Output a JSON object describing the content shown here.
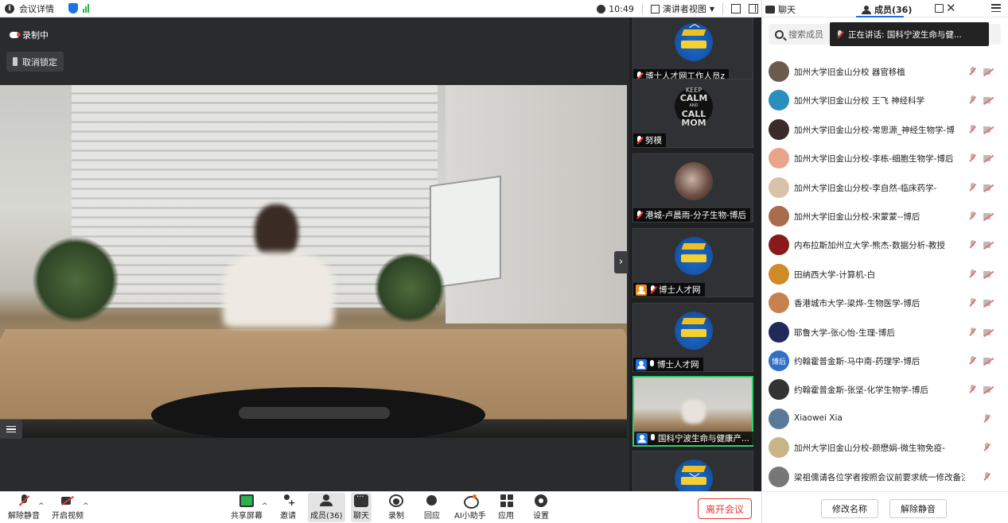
{
  "topbar": {
    "meeting_info": "会议详情",
    "time": "10:49",
    "view_mode": "演讲者视图"
  },
  "stage": {
    "recording": "录制中",
    "unlock": "取消锁定"
  },
  "thumbnails": [
    {
      "name": "博士人才网工作人员z",
      "mic": "off",
      "avatar": "logo-avatar"
    },
    {
      "name": "努模",
      "mic": "off",
      "avatar": "keep-calm-avatar",
      "avatar_text": [
        "KEEP",
        "CALM",
        "AND",
        "CALL",
        "MOM"
      ]
    },
    {
      "name": "港城-卢晨雨-分子生物-博后",
      "mic": "off",
      "avatar": "cat-avatar"
    },
    {
      "name": "博士人才网",
      "mic": "off",
      "avatar": "logo-avatar",
      "host_color": "#f08c1a"
    },
    {
      "name": "博士人才网",
      "mic": "on",
      "avatar": "logo-avatar",
      "host_color": "#1a73e8"
    },
    {
      "name": "国科宁波生命与健康产...",
      "mic": "on",
      "avatar": "video",
      "host_color": "#1a73e8",
      "active": true
    }
  ],
  "toolbar": {
    "unmute": "解除静音",
    "start_video": "开启视频",
    "share": "共享屏幕",
    "invite": "邀请",
    "members": "成员(36)",
    "chat": "聊天",
    "record": "录制",
    "react": "回应",
    "ai": "AI小助手",
    "apps": "应用",
    "settings": "设置",
    "leave": "离开会议"
  },
  "panel": {
    "tab_chat": "聊天",
    "tab_members": "成员(36)",
    "search_placeholder": "搜索成员",
    "speaking": "正在讲话: 国科宁波生命与健...",
    "members": [
      {
        "name": "加州大学旧金山分校 器官移植",
        "av": "#6b5a4e",
        "video": true
      },
      {
        "name": "加州大学旧金山分校 王飞 神经科学",
        "av": "#2a8fbf",
        "video": true
      },
      {
        "name": "加州大学旧金山分校-常思源_神经生物学-博",
        "av": "#3b2a2a",
        "video": true
      },
      {
        "name": "加州大学旧金山分校-李栋-细胞生物学-博后",
        "av": "#e8a58a",
        "video": true
      },
      {
        "name": "加州大学旧金山分校-李自然-临床药学-",
        "av": "#d9c3a8",
        "video": true
      },
      {
        "name": "加州大学旧金山分校-宋蒙蒙--博后",
        "av": "#a86b4b",
        "video": true
      },
      {
        "name": "内布拉斯加州立大学-熊杰-数据分析-教授",
        "av": "#8a1a1a",
        "video": true
      },
      {
        "name": "田纳西大学-计算机-白",
        "av": "#d08a2a",
        "video": true
      },
      {
        "name": "香港城市大学-梁烨-生物医学-博后",
        "av": "#c7814f",
        "video": true
      },
      {
        "name": "耶鲁大学-张心怡-生理-博后",
        "av": "#1f2a5a",
        "video": true
      },
      {
        "name": "约翰霍普金斯-马中南-药理学-博后",
        "av": "#2f6fc4",
        "av_text": "博后",
        "video": true
      },
      {
        "name": "约翰霍普金斯-张坚-化学生物学-博后",
        "av": "#333333",
        "video": true
      },
      {
        "name": "Xiaowei Xia",
        "av": "#5a7a9a",
        "video": false
      },
      {
        "name": "加州大学旧金山分校-颜懋娟-微生物免疫-",
        "av": "#c9b48a",
        "video": false
      },
      {
        "name": "梁祖儒请各位学者按照会议前要求统一修改备注：毕业院...",
        "av": "#777777",
        "video": false
      }
    ],
    "rename": "修改名称",
    "unmute": "解除静音"
  }
}
